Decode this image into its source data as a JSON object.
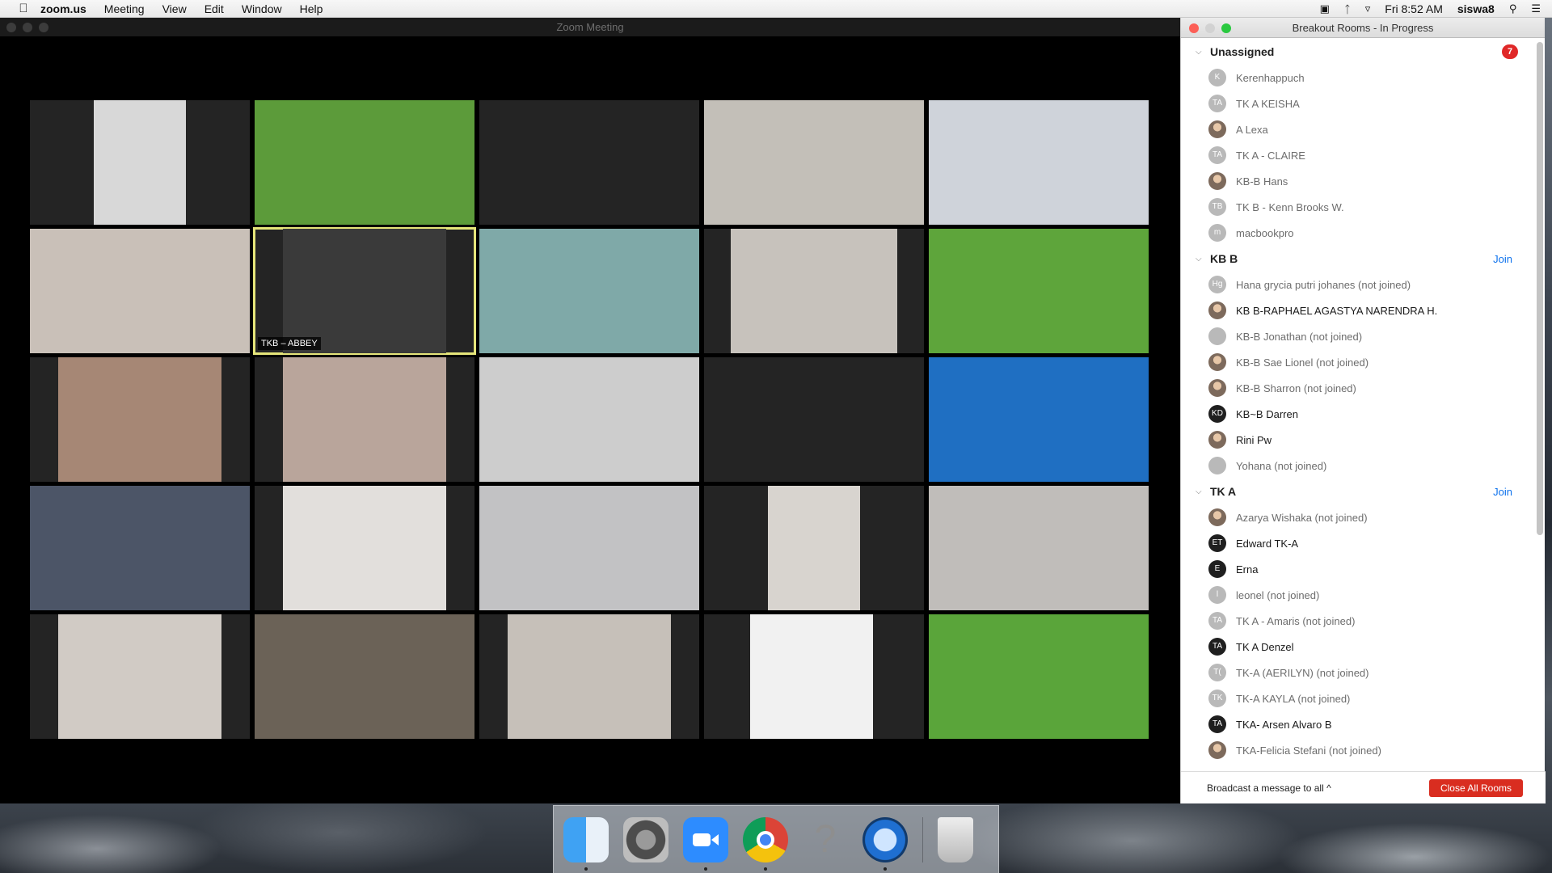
{
  "menubar": {
    "app_name": "zoom.us",
    "menus": [
      "Meeting",
      "View",
      "Edit",
      "Window",
      "Help"
    ],
    "clock": "Fri 8:52 AM",
    "user": "siswa8"
  },
  "zoom_window": {
    "title": "Zoom Meeting",
    "active_speaker_label": "TKB – ABBEY",
    "tiles": [
      {
        "bg": "#d8d8d8",
        "inner": [
          29,
          42
        ]
      },
      {
        "bg": "#5c9b3a",
        "inner": [
          0,
          100
        ]
      },
      {
        "bg": "#242424",
        "inner": [
          0,
          0
        ]
      },
      {
        "bg": "#c3bfb8",
        "inner": [
          0,
          100
        ]
      },
      {
        "bg": "#cfd3da",
        "inner": [
          0,
          100
        ]
      },
      {
        "bg": "#c9c0b8",
        "inner": [
          0,
          100
        ]
      },
      {
        "bg": "#3a3a3a",
        "inner": [
          13,
          74
        ]
      },
      {
        "bg": "#7fa9a8",
        "inner": [
          0,
          100
        ]
      },
      {
        "bg": "#c7c2bc",
        "inner": [
          12,
          76
        ]
      },
      {
        "bg": "#5ea53b",
        "inner": [
          0,
          100
        ]
      },
      {
        "bg": "#a68775",
        "inner": [
          13,
          74
        ]
      },
      {
        "bg": "#b9a59b",
        "inner": [
          13,
          74
        ]
      },
      {
        "bg": "#cdcdcd",
        "inner": [
          0,
          100
        ]
      },
      {
        "bg": "#242424",
        "inner": [
          0,
          0
        ]
      },
      {
        "bg": "#1f6fc2",
        "inner": [
          0,
          100
        ]
      },
      {
        "bg": "#4c5567",
        "inner": [
          0,
          100
        ]
      },
      {
        "bg": "#e2dfdc",
        "inner": [
          13,
          74
        ]
      },
      {
        "bg": "#c2c2c4",
        "inner": [
          0,
          100
        ]
      },
      {
        "bg": "#d8d4cf",
        "inner": [
          29,
          42
        ]
      },
      {
        "bg": "#c0bdba",
        "inner": [
          0,
          100
        ]
      },
      {
        "bg": "#d1cbc5",
        "inner": [
          13,
          74
        ]
      },
      {
        "bg": "#6b6257",
        "inner": [
          0,
          100
        ]
      },
      {
        "bg": "#c6c0b9",
        "inner": [
          13,
          74
        ]
      },
      {
        "bg": "#f1f1f1",
        "inner": [
          21,
          56
        ]
      },
      {
        "bg": "#5aa53a",
        "inner": [
          0,
          100
        ]
      }
    ]
  },
  "breakout": {
    "title": "Breakout Rooms - In Progress",
    "unassigned": {
      "name": "Unassigned",
      "count": "7",
      "participants": [
        {
          "initials": "K",
          "name": "Kerenhappuch",
          "style": "light",
          "joined": false
        },
        {
          "initials": "TA",
          "name": "TK A KEISHA",
          "style": "light",
          "joined": false
        },
        {
          "initials": "",
          "name": "A Lexa",
          "style": "photo",
          "joined": false
        },
        {
          "initials": "TA",
          "name": "TK A - CLAIRE",
          "style": "light",
          "joined": false
        },
        {
          "initials": "",
          "name": "KB-B Hans",
          "style": "photo",
          "joined": false
        },
        {
          "initials": "TB",
          "name": "TK B - Kenn Brooks W.",
          "style": "light",
          "joined": false
        },
        {
          "initials": "m",
          "name": "macbookpro",
          "style": "light",
          "joined": false
        }
      ]
    },
    "kbb": {
      "name": "KB B",
      "join_label": "Join",
      "participants": [
        {
          "initials": "Hg",
          "name": "Hana grycia putri johanes (not joined)",
          "style": "light",
          "joined": false
        },
        {
          "initials": "",
          "name": "KB  B-RAPHAEL AGASTYA NARENDRA H.",
          "style": "photo",
          "joined": true
        },
        {
          "initials": "",
          "name": "KB-B Jonathan (not joined)",
          "style": "light",
          "joined": false
        },
        {
          "initials": "",
          "name": "KB-B Sae Lionel (not joined)",
          "style": "photo",
          "joined": false
        },
        {
          "initials": "",
          "name": "KB-B Sharron (not joined)",
          "style": "photo",
          "joined": false
        },
        {
          "initials": "KD",
          "name": "KB~B Darren",
          "style": "dark",
          "joined": true
        },
        {
          "initials": "",
          "name": "Rini Pw",
          "style": "photo",
          "joined": true
        },
        {
          "initials": "",
          "name": "Yohana (not joined)",
          "style": "light",
          "joined": false
        }
      ]
    },
    "tka": {
      "name": "TK A",
      "join_label": "Join",
      "participants": [
        {
          "initials": "",
          "name": "Azarya Wishaka (not joined)",
          "style": "photo",
          "joined": false
        },
        {
          "initials": "ET",
          "name": "Edward TK-A",
          "style": "dark",
          "joined": true
        },
        {
          "initials": "E",
          "name": "Erna",
          "style": "dark",
          "joined": true
        },
        {
          "initials": "l",
          "name": "leonel (not joined)",
          "style": "light",
          "joined": false
        },
        {
          "initials": "TA",
          "name": "TK A - Amaris (not joined)",
          "style": "light",
          "joined": false
        },
        {
          "initials": "TA",
          "name": "TK A Denzel",
          "style": "dark",
          "joined": true
        },
        {
          "initials": "T(",
          "name": "TK-A (AERILYN) (not joined)",
          "style": "light",
          "joined": false
        },
        {
          "initials": "TK",
          "name": "TK-A KAYLA (not joined)",
          "style": "light",
          "joined": false
        },
        {
          "initials": "TA",
          "name": "TKA- Arsen Alvaro B",
          "style": "dark",
          "joined": true
        },
        {
          "initials": "",
          "name": "TKA-Felicia Stefani (not joined)",
          "style": "photo",
          "joined": false
        }
      ]
    },
    "footer": {
      "broadcast": "Broadcast a message to all ^",
      "close_all": "Close All Rooms"
    }
  },
  "dock": {
    "icons": [
      "finder-icon",
      "system-preferences-icon",
      "zoom-icon",
      "chrome-icon",
      "help-icon",
      "quicktime-icon",
      "trash-icon"
    ]
  }
}
